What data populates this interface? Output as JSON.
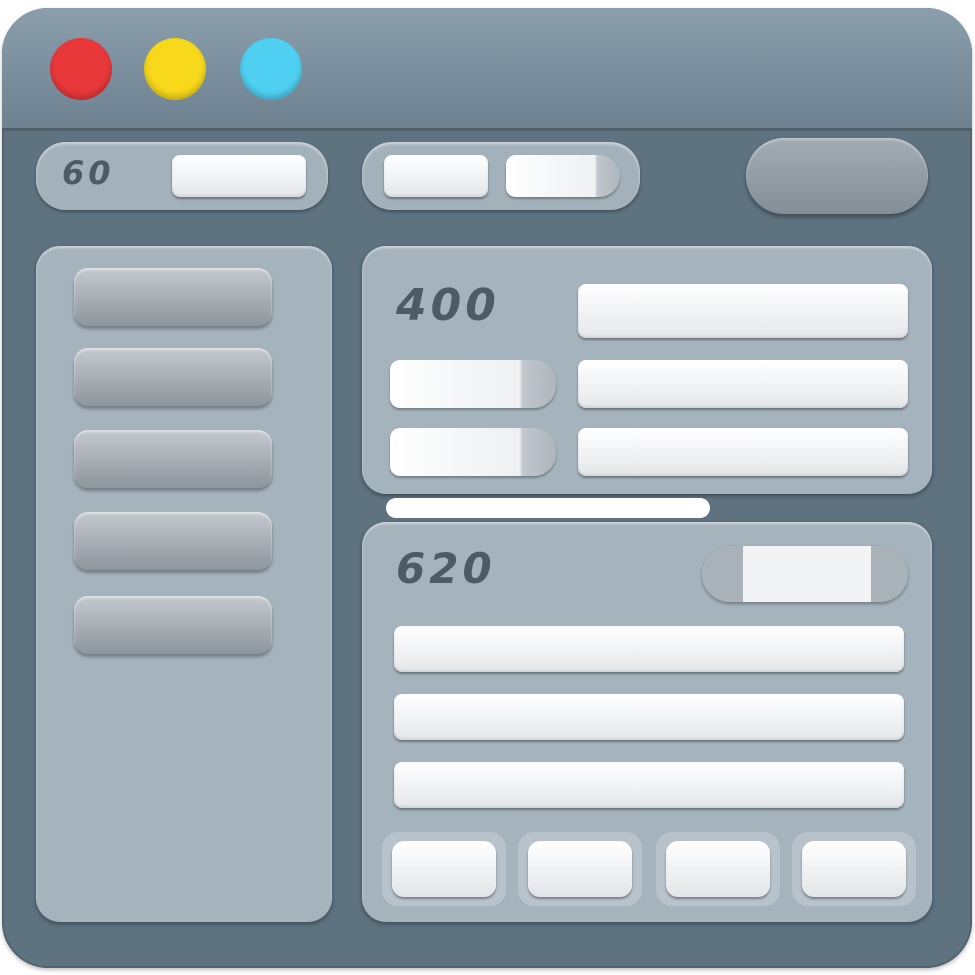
{
  "window": {
    "traffic_lights": [
      {
        "name": "close",
        "color": "#e8383a"
      },
      {
        "name": "minimize",
        "color": "#f7d81b"
      },
      {
        "name": "maximize",
        "color": "#4fd0f2"
      }
    ]
  },
  "toolbar": {
    "group_label": "60"
  },
  "panels": {
    "top_label": "400",
    "bottom_label": "620"
  },
  "sidebar": {
    "items": [
      {},
      {},
      {},
      {},
      {}
    ]
  },
  "colors": {
    "frame": "#5e7280",
    "titlebar": "#7f93a1",
    "panel": "#a5b3bd",
    "field": "#f4f5f6"
  }
}
